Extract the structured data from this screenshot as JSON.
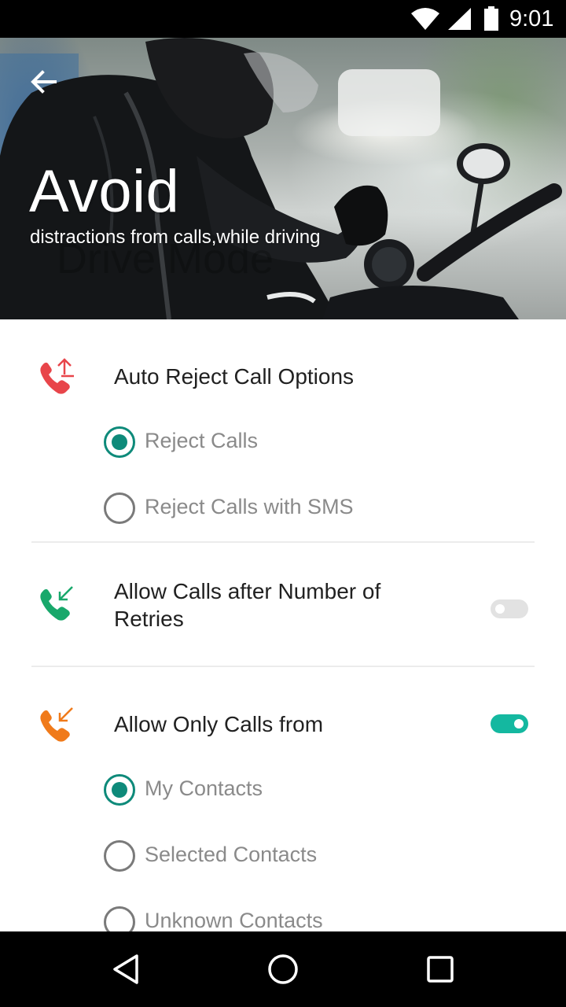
{
  "status_bar": {
    "time": "9:01",
    "icons": [
      "wifi-icon",
      "signal-icon",
      "battery-icon"
    ]
  },
  "header": {
    "back_icon": "arrow-left-icon",
    "title": "Avoid",
    "subtitle": "distractions from calls,while driving",
    "watermark": "Drive Mode"
  },
  "sections": {
    "auto_reject": {
      "title": "Auto Reject Call Options",
      "icon": "phone-outgoing-icon",
      "icon_color": "#e8454a",
      "options": [
        {
          "label": "Reject Calls",
          "checked": true
        },
        {
          "label": "Reject Calls with SMS",
          "checked": false
        }
      ]
    },
    "allow_retries": {
      "title_line1": "Allow Calls after Number of",
      "title_line2": "Retries",
      "icon": "phone-incoming-icon",
      "icon_color": "#18a86b",
      "enabled": false
    },
    "allow_only": {
      "title": "Allow Only Calls from",
      "icon": "phone-incoming-icon",
      "icon_color": "#f07a1a",
      "enabled": true,
      "options": [
        {
          "label": "My Contacts",
          "checked": true
        },
        {
          "label": "Selected Contacts",
          "checked": false
        },
        {
          "label": "Unknown Contacts",
          "checked": false
        }
      ]
    }
  },
  "colors": {
    "accent": "#0e8a7a",
    "toggle_on": "#14b8a0",
    "toggle_off": "#e2e2e2"
  },
  "nav_bar": {
    "buttons": [
      "back-triangle-icon",
      "home-circle-icon",
      "recents-square-icon"
    ]
  }
}
